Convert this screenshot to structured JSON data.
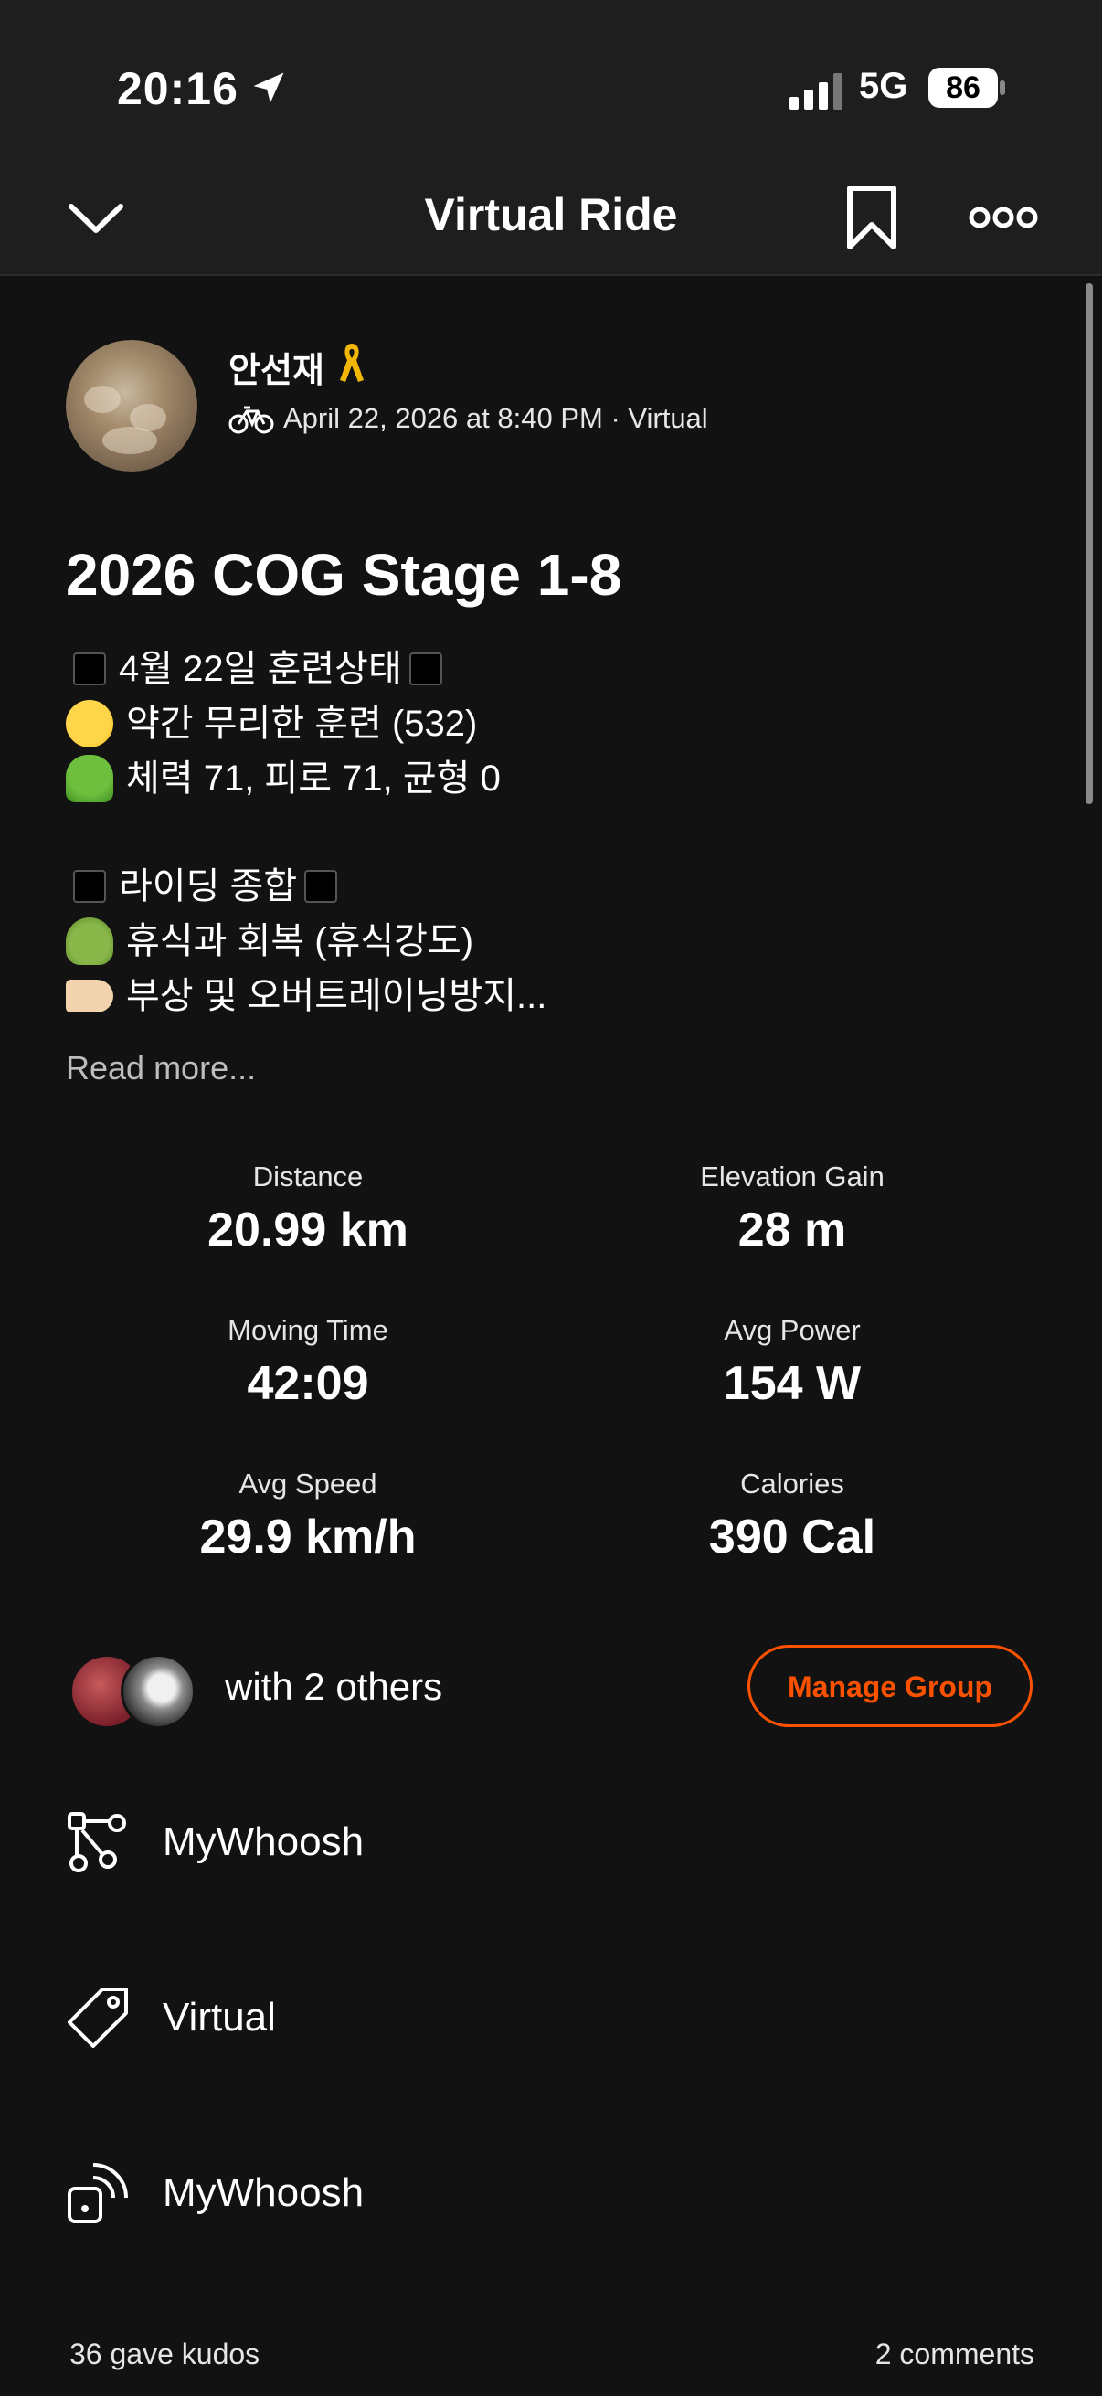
{
  "status_bar": {
    "time": "20:16",
    "network": "5G",
    "battery": "86"
  },
  "nav": {
    "title": "Virtual Ride"
  },
  "athlete": {
    "name": "안선재",
    "meta": "April 22, 2026 at 8:40 PM · Virtual"
  },
  "activity": {
    "title": "2026 COG Stage 1-8",
    "description": [
      "4월 22일 훈련상태",
      "약간 무리한 훈련 (532)",
      "체력 71, 피로 71, 균형 0",
      "라이딩 종합",
      "휴식과 회복 (휴식강도)",
      "부상 및 오버트레이닝방지..."
    ],
    "read_more": "Read more..."
  },
  "stats": [
    {
      "label": "Distance",
      "value": "20.99 km"
    },
    {
      "label": "Elevation Gain",
      "value": "28 m"
    },
    {
      "label": "Moving Time",
      "value": "42:09"
    },
    {
      "label": "Avg Power",
      "value": "154 W"
    },
    {
      "label": "Avg Speed",
      "value": "29.9 km/h"
    },
    {
      "label": "Calories",
      "value": "390 Cal"
    }
  ],
  "group": {
    "with_text": "with 2 others",
    "manage_label": "Manage Group"
  },
  "details": [
    {
      "icon": "route-icon",
      "label": "MyWhoosh"
    },
    {
      "icon": "tag-icon",
      "label": "Virtual"
    },
    {
      "icon": "device-sync-icon",
      "label": "MyWhoosh"
    }
  ],
  "footer": {
    "kudos": "36 gave kudos",
    "comments": "2 comments"
  },
  "colors": {
    "accent": "#fc5200",
    "background": "#121212",
    "bar": "#1e1e1e"
  }
}
